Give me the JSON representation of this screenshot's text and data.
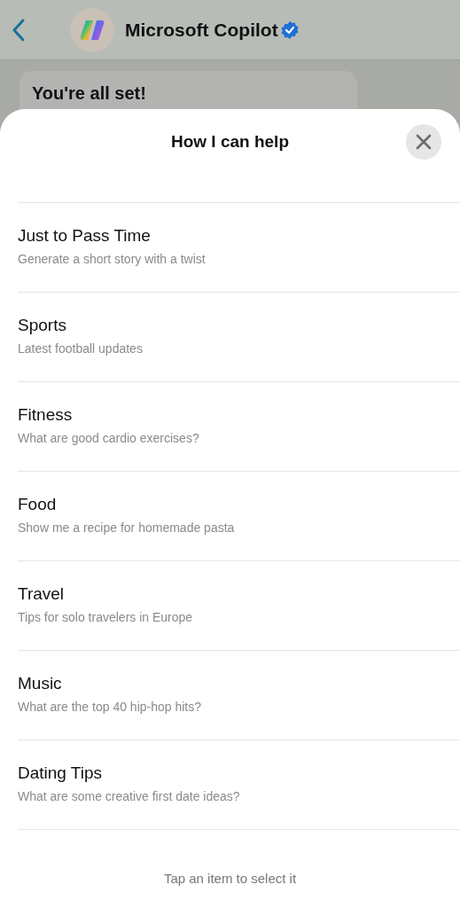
{
  "header": {
    "title": "Microsoft Copilot",
    "verified": true
  },
  "message": {
    "text": "You're all set!"
  },
  "sheet": {
    "title": "How I can help",
    "items": [
      {
        "title": "Just to Pass Time",
        "subtitle": "Generate a short story with a twist"
      },
      {
        "title": "Sports",
        "subtitle": "Latest football updates"
      },
      {
        "title": "Fitness",
        "subtitle": "What are good cardio exercises?"
      },
      {
        "title": "Food",
        "subtitle": "Show me a recipe for homemade pasta"
      },
      {
        "title": "Travel",
        "subtitle": "Tips for solo travelers in Europe"
      },
      {
        "title": "Music",
        "subtitle": "What are the top 40 hip-hop hits?"
      },
      {
        "title": "Dating Tips",
        "subtitle": "What are some creative first date ideas?"
      }
    ],
    "footer": "Tap an item to select it"
  }
}
